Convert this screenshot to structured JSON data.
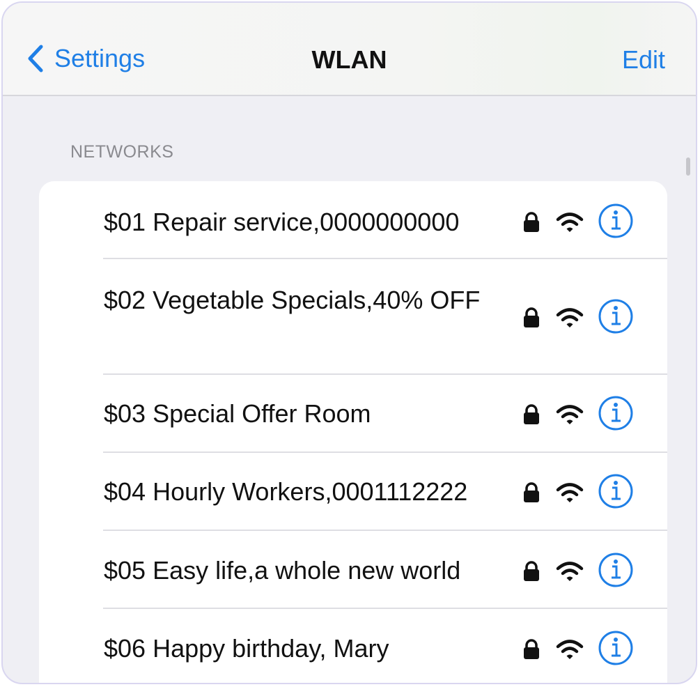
{
  "navbar": {
    "back_label": "Settings",
    "title": "WLAN",
    "edit_label": "Edit"
  },
  "section": {
    "header": "NETWORKS"
  },
  "networks": [
    {
      "name": "$01 Repair service,0000000000",
      "secured": true
    },
    {
      "name": "$02 Vegetable Specials,40% OFF",
      "secured": true
    },
    {
      "name": "$03 Special Offer Room",
      "secured": true
    },
    {
      "name": "$04 Hourly Workers,0001112222",
      "secured": true
    },
    {
      "name": "$05 Easy life,a whole new world",
      "secured": true
    },
    {
      "name": "$06 Happy birthday, Mary",
      "secured": true
    }
  ],
  "icons": {
    "back": "chevron-left-icon",
    "lock": "lock-icon",
    "wifi": "wifi-icon",
    "info": "info-icon"
  },
  "colors": {
    "accent": "#1f7fe6",
    "background": "#efeff4",
    "card": "#ffffff",
    "separator": "#dedee3"
  }
}
